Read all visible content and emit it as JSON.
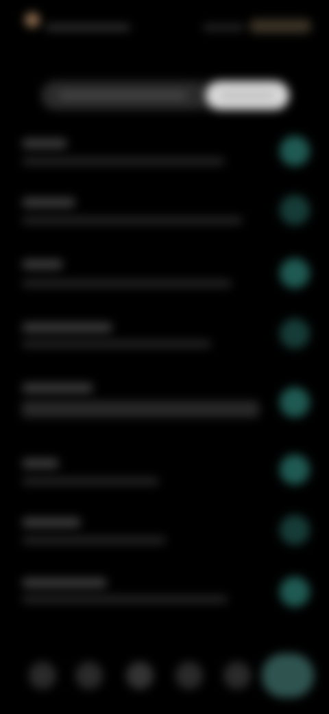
{
  "status_bar": {
    "time": "",
    "indicators": ""
  },
  "segmented_control": {
    "left_label": "",
    "right_label": "",
    "selected": "right"
  },
  "settings_rows": [
    {
      "title": "",
      "subtitle": "",
      "toggle_on": true
    },
    {
      "title": "",
      "subtitle": "",
      "toggle_on": false
    },
    {
      "title": "",
      "subtitle": "",
      "toggle_on": true
    },
    {
      "title": "",
      "subtitle": "",
      "toggle_on": false
    },
    {
      "title": "",
      "subtitle": "",
      "toggle_on": true
    },
    {
      "title": "",
      "subtitle": "",
      "toggle_on": true
    },
    {
      "title": "",
      "subtitle": "",
      "toggle_on": false
    },
    {
      "title": "",
      "subtitle": "",
      "toggle_on": true
    }
  ],
  "bottom_nav": {
    "items": [
      {
        "icon": "nav-icon"
      },
      {
        "icon": "nav-icon"
      },
      {
        "icon": "nav-icon"
      },
      {
        "icon": "nav-icon"
      },
      {
        "icon": "nav-icon"
      }
    ],
    "action_icon": "action-icon"
  },
  "colors": {
    "background": "#000000",
    "accent": "#1f5a52",
    "segment_selected": "#d9d9d9",
    "status_accent": "#b98f68"
  }
}
